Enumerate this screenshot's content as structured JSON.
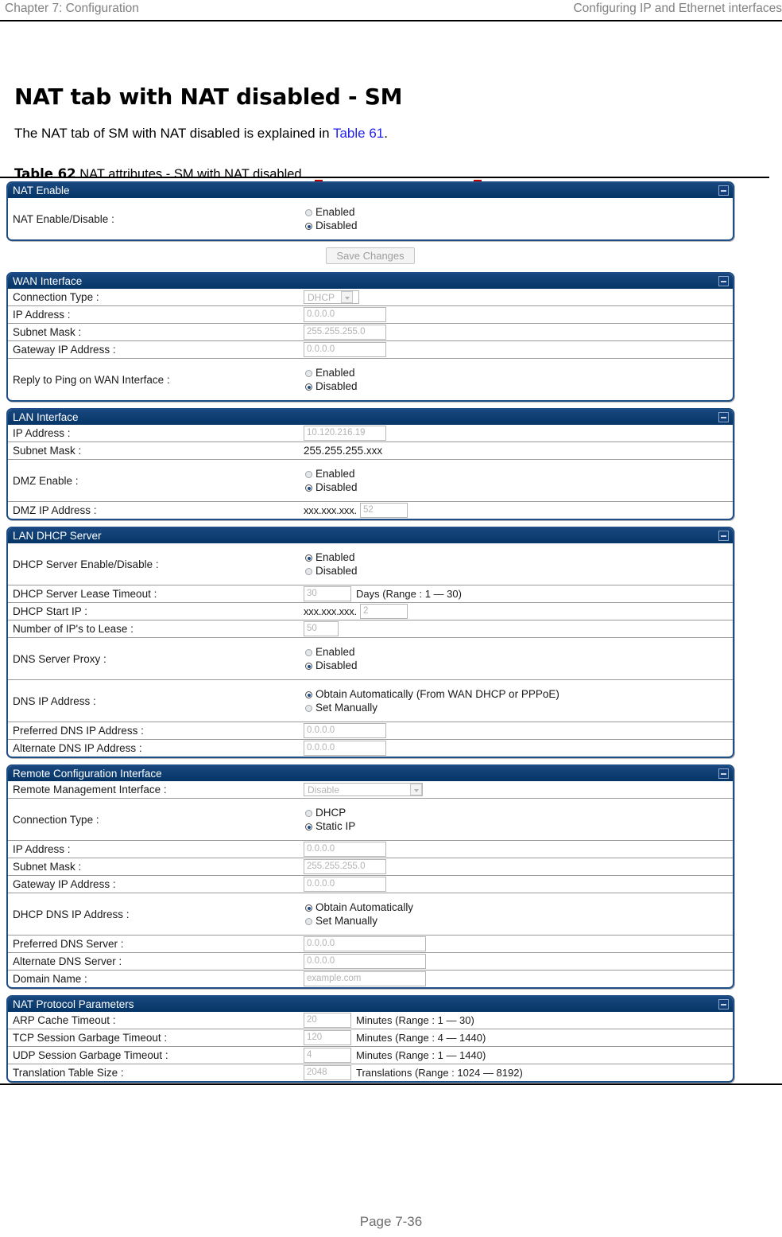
{
  "page": {
    "header_left": "Chapter 7:  Configuration",
    "header_right": "Configuring IP and Ethernet interfaces",
    "heading": "NAT tab with NAT disabled - SM",
    "intro_before": "The NAT tab of SM with NAT disabled is explained in ",
    "intro_link": "Table 61",
    "intro_after": ".",
    "caption_label": "Table 62",
    "caption_text": " NAT attributes - SM with NAT disabled",
    "footer": "Page 7-36",
    "link_color": "#2222ee",
    "panel_header_color": "#0c3d77",
    "panel_border_color": "#1f4e87"
  },
  "save_button": "Save Changes",
  "panels": {
    "nat_enable": {
      "title": "NAT Enable",
      "rows": [
        {
          "label": "NAT Enable/Disable :",
          "options": [
            {
              "text": "Enabled",
              "selected": false
            },
            {
              "text": "Disabled",
              "selected": true
            }
          ]
        }
      ]
    },
    "wan_interface": {
      "title": "WAN Interface",
      "connection_type_label": "Connection Type :",
      "connection_type_value": "DHCP",
      "ip_address_label": "IP Address :",
      "ip_address_value": "0.0.0.0",
      "subnet_mask_label": "Subnet Mask :",
      "subnet_mask_value": "255.255.255.0",
      "gateway_label": "Gateway IP Address :",
      "gateway_value": "0.0.0.0",
      "ping_label": "Reply to Ping on WAN Interface :",
      "ping_enabled": "Enabled",
      "ping_disabled": "Disabled"
    },
    "lan_interface": {
      "title": "LAN Interface",
      "ip_address_label": "IP Address :",
      "ip_address_value": "10.120.216.19",
      "subnet_mask_label": "Subnet Mask :",
      "subnet_mask_value": "255.255.255.xxx",
      "dmz_enable_label": "DMZ Enable :",
      "dmz_enabled": "Enabled",
      "dmz_disabled": "Disabled",
      "dmz_ip_label": "DMZ IP Address :",
      "dmz_ip_prefix": "xxx.xxx.xxx.",
      "dmz_ip_value": "52"
    },
    "lan_dhcp_server": {
      "title": "LAN DHCP Server",
      "enable_label": "DHCP Server Enable/Disable :",
      "enable_enabled": "Enabled",
      "enable_disabled": "Disabled",
      "lease_timeout_label": "DHCP Server Lease Timeout :",
      "lease_timeout_value": "30",
      "lease_timeout_hint": "Days (Range : 1 — 30)",
      "start_ip_label": "DHCP Start IP :",
      "start_ip_prefix": "xxx.xxx.xxx.",
      "start_ip_value": "2",
      "num_ips_label": "Number of IP's to Lease :",
      "num_ips_value": "50",
      "dns_proxy_label": "DNS Server Proxy :",
      "dns_proxy_enabled": "Enabled",
      "dns_proxy_disabled": "Disabled",
      "dns_ip_label": "DNS IP Address :",
      "dns_ip_auto": "Obtain Automatically (From WAN DHCP or PPPoE)",
      "dns_ip_manual": "Set Manually",
      "preferred_dns_label": "Preferred DNS IP Address :",
      "preferred_dns_value": "0.0.0.0",
      "alternate_dns_label": "Alternate DNS IP Address :",
      "alternate_dns_value": "0.0.0.0"
    },
    "remote_configuration": {
      "title": "Remote Configuration Interface",
      "remote_mgmt_label": "Remote Management Interface :",
      "remote_mgmt_value": "Disable",
      "connection_type_label": "Connection Type :",
      "connection_dhcp": "DHCP",
      "connection_static": "Static IP",
      "ip_address_label": "IP Address :",
      "ip_address_value": "0.0.0.0",
      "subnet_mask_label": "Subnet Mask :",
      "subnet_mask_value": "255.255.255.0",
      "gateway_label": "Gateway IP Address :",
      "gateway_value": "0.0.0.0",
      "dhcp_dns_label": "DHCP DNS IP Address :",
      "dhcp_dns_auto": "Obtain Automatically",
      "dhcp_dns_manual": "Set Manually",
      "preferred_dns_label": "Preferred DNS Server :",
      "preferred_dns_value": "0.0.0.0",
      "alternate_dns_label": "Alternate DNS Server :",
      "alternate_dns_value": "0.0.0.0",
      "domain_name_label": "Domain Name :",
      "domain_name_value": "example.com"
    },
    "nat_protocol": {
      "title": "NAT Protocol Parameters",
      "arp_label": "ARP Cache Timeout :",
      "arp_value": "20",
      "arp_hint": "Minutes (Range : 1 — 30)",
      "tcp_label": "TCP Session Garbage Timeout :",
      "tcp_value": "120",
      "tcp_hint": "Minutes (Range : 4 — 1440)",
      "udp_label": "UDP Session Garbage Timeout :",
      "udp_value": "4",
      "udp_hint": "Minutes (Range : 1 — 1440)",
      "table_size_label": "Translation Table Size :",
      "table_size_value": "2048",
      "table_size_hint": "Translations (Range : 1024 — 8192)"
    }
  }
}
